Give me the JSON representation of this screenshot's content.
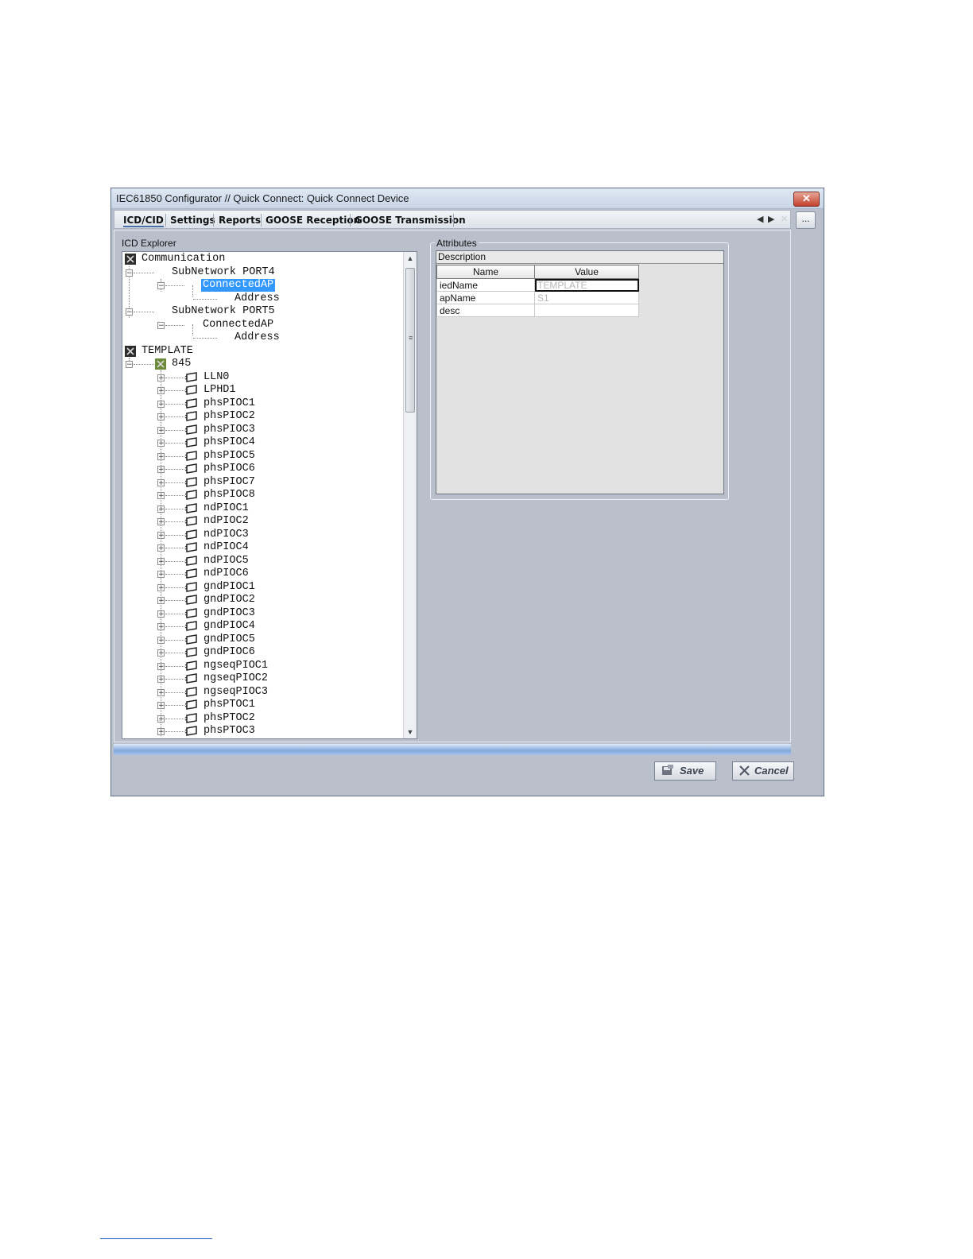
{
  "window": {
    "title": "IEC61850 Configurator // Quick Connect: Quick Connect Device",
    "close_label": "✕"
  },
  "tabs": [
    {
      "label": "ICD/CID",
      "active": true
    },
    {
      "label": "Settings"
    },
    {
      "label": "Reports"
    },
    {
      "label": "GOOSE Reception"
    },
    {
      "label": "GOOSE Transmission"
    }
  ],
  "tab_nav": {
    "prev": "◀",
    "next": "▶",
    "close": "✕",
    "more": "..."
  },
  "explorer": {
    "label": "ICD Explorer",
    "nodes": [
      {
        "label": "Communication",
        "icon": "communication-icon"
      },
      {
        "label": "SubNetwork PORT4",
        "expander": "⊟"
      },
      {
        "label": "ConnectedAP",
        "expander": "⊟",
        "selected": true
      },
      {
        "label": "Address"
      },
      {
        "label": "SubNetwork PORT5",
        "expander": "⊟"
      },
      {
        "label": "ConnectedAP",
        "expander": "⊟"
      },
      {
        "label": "Address"
      },
      {
        "label": "TEMPLATE",
        "icon": "ied-icon"
      },
      {
        "label": "845",
        "expander": "⊟",
        "icon": "logical-device-icon"
      },
      {
        "label": "LLN0"
      },
      {
        "label": "LPHD1"
      },
      {
        "label": "phsPIOC1"
      },
      {
        "label": "phsPIOC2"
      },
      {
        "label": "phsPIOC3"
      },
      {
        "label": "phsPIOC4"
      },
      {
        "label": "phsPIOC5"
      },
      {
        "label": "phsPIOC6"
      },
      {
        "label": "phsPIOC7"
      },
      {
        "label": "phsPIOC8"
      },
      {
        "label": "ndPIOC1"
      },
      {
        "label": "ndPIOC2"
      },
      {
        "label": "ndPIOC3"
      },
      {
        "label": "ndPIOC4"
      },
      {
        "label": "ndPIOC5"
      },
      {
        "label": "ndPIOC6"
      },
      {
        "label": "gndPIOC1"
      },
      {
        "label": "gndPIOC2"
      },
      {
        "label": "gndPIOC3"
      },
      {
        "label": "gndPIOC4"
      },
      {
        "label": "gndPIOC5"
      },
      {
        "label": "gndPIOC6"
      },
      {
        "label": "ngseqPIOC1"
      },
      {
        "label": "ngseqPIOC2"
      },
      {
        "label": "ngseqPIOC3"
      },
      {
        "label": "phsPTOC1"
      },
      {
        "label": "phsPTOC2"
      },
      {
        "label": "phsPTOC3"
      }
    ],
    "logical_node_expander": "⊞",
    "scroll_up": "▲",
    "scroll_down": "▼",
    "scroll_grip": "≡"
  },
  "attributes": {
    "legend": "Attributes",
    "description_header": "Description",
    "columns": [
      "Name",
      "Value"
    ],
    "rows": [
      {
        "name": "iedName",
        "value": "TEMPLATE"
      },
      {
        "name": "apName",
        "value": "S1"
      },
      {
        "name": "desc",
        "value": ""
      }
    ]
  },
  "footer": {
    "save_label": "Save",
    "cancel_label": "Cancel",
    "save_icon": "save-icon",
    "cancel_icon": "cancel-icon"
  },
  "colors": {
    "selection": "#3399ff",
    "window_bg": "#b9bfcb",
    "close_red": "#c3422c"
  }
}
